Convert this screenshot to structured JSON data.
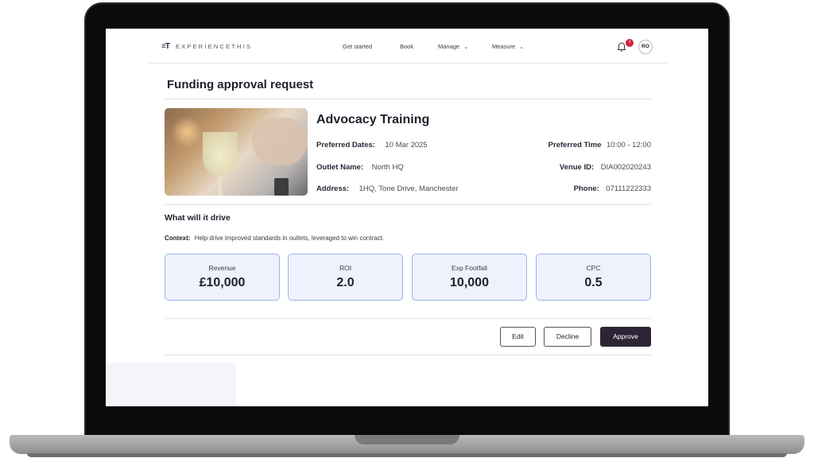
{
  "nav": {
    "logo_mark": "≡T",
    "logo_text": "EXPERIENCETHIS",
    "links": [
      "Get started",
      "Book",
      "Manage",
      "Measure"
    ],
    "notification_count": "7",
    "avatar_initials": "RO"
  },
  "page": {
    "title": "Funding approval request"
  },
  "event": {
    "name": "Advocacy Training",
    "preferred_dates_label": "Preferred Dates:",
    "preferred_dates": "10 Mar 2025",
    "outlet_name_label": "Outlet Name:",
    "outlet_name": "North HQ",
    "address_label": "Address:",
    "address": "1HQ, Tone Drive, Manchester",
    "preferred_time_label": "Preferred Time",
    "preferred_time": "10:00 - 12:00",
    "venue_id_label": "Venue ID:",
    "venue_id": "DIA002020243",
    "phone_label": "Phone:",
    "phone": "07111222333"
  },
  "drive": {
    "title": "What will it drive",
    "context_label": "Context:",
    "context": "Help drive improved standards in outlets, leveraged to win contract."
  },
  "kpis": [
    {
      "label": "Revenue",
      "value": "£10,000"
    },
    {
      "label": "ROI",
      "value": "2.0"
    },
    {
      "label": "Exp Footfall",
      "value": "10,000"
    },
    {
      "label": "CPC",
      "value": "0.5"
    }
  ],
  "actions": {
    "edit": "Edit",
    "decline": "Decline",
    "approve": "Approve"
  },
  "colors": {
    "accent_dark": "#2d2535",
    "kpi_border": "#9fb2ea",
    "kpi_bg": "#eef2fc",
    "badge": "#d3243a"
  }
}
